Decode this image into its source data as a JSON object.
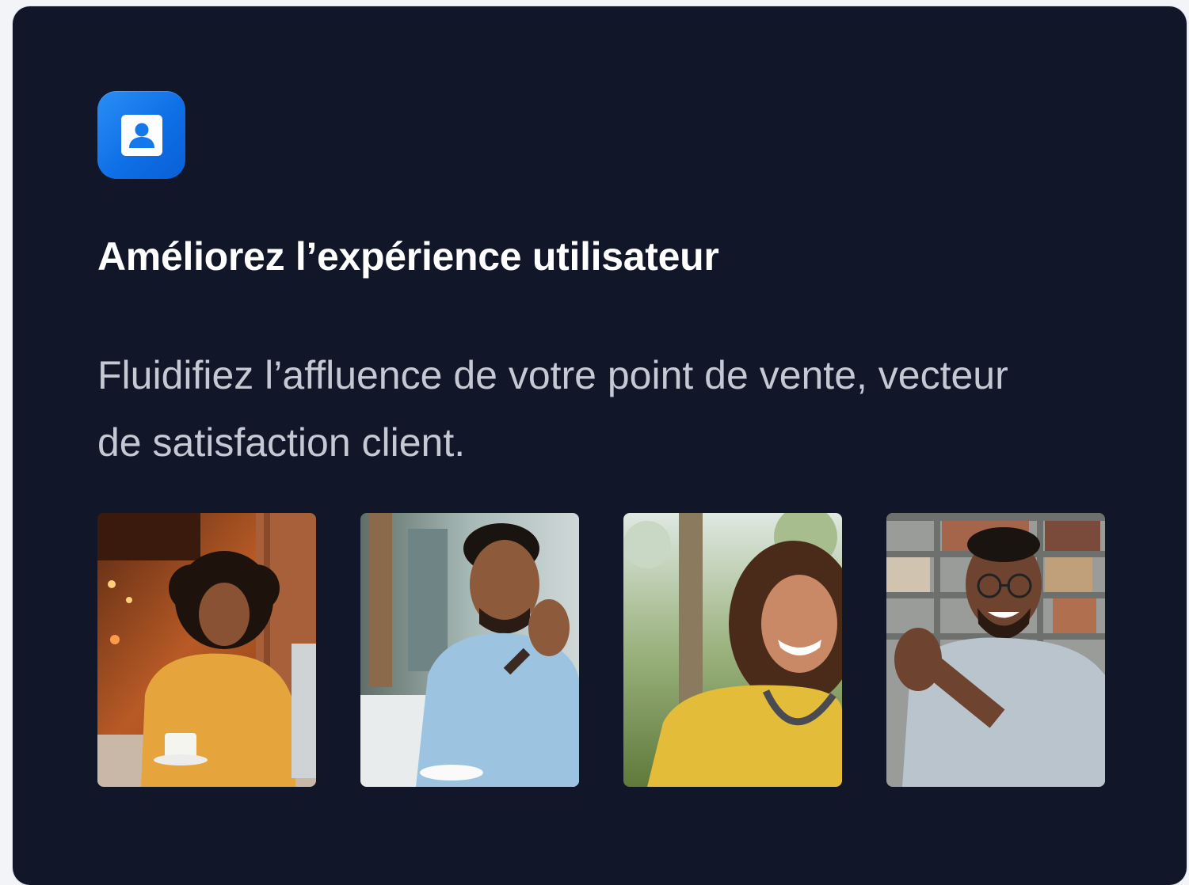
{
  "feature_card": {
    "icon": "contact-card-icon",
    "title": "Améliorez l’expérience utilisateur",
    "description": "Fluidifiez l’affluence de votre point de vente, vecteur de satisfaction client."
  },
  "photos": [
    {
      "name": "photo-woman-laptop-cafe",
      "subject": "smiling woman with curly hair at a laptop with a coffee cup"
    },
    {
      "name": "photo-man-smiling-hand-chin",
      "subject": "smiling man in light blue shirt resting chin on hand"
    },
    {
      "name": "photo-woman-smiling-outdoors",
      "subject": "smiling woman in yellow top outdoors"
    },
    {
      "name": "photo-man-glasses-bookshelf",
      "subject": "smiling man with glasses in front of bookshelf"
    }
  ],
  "colors": {
    "card_background": "#111729",
    "icon_gradient": "#1a7ff0",
    "title": "#ffffff",
    "description": "#c4c9d4"
  }
}
